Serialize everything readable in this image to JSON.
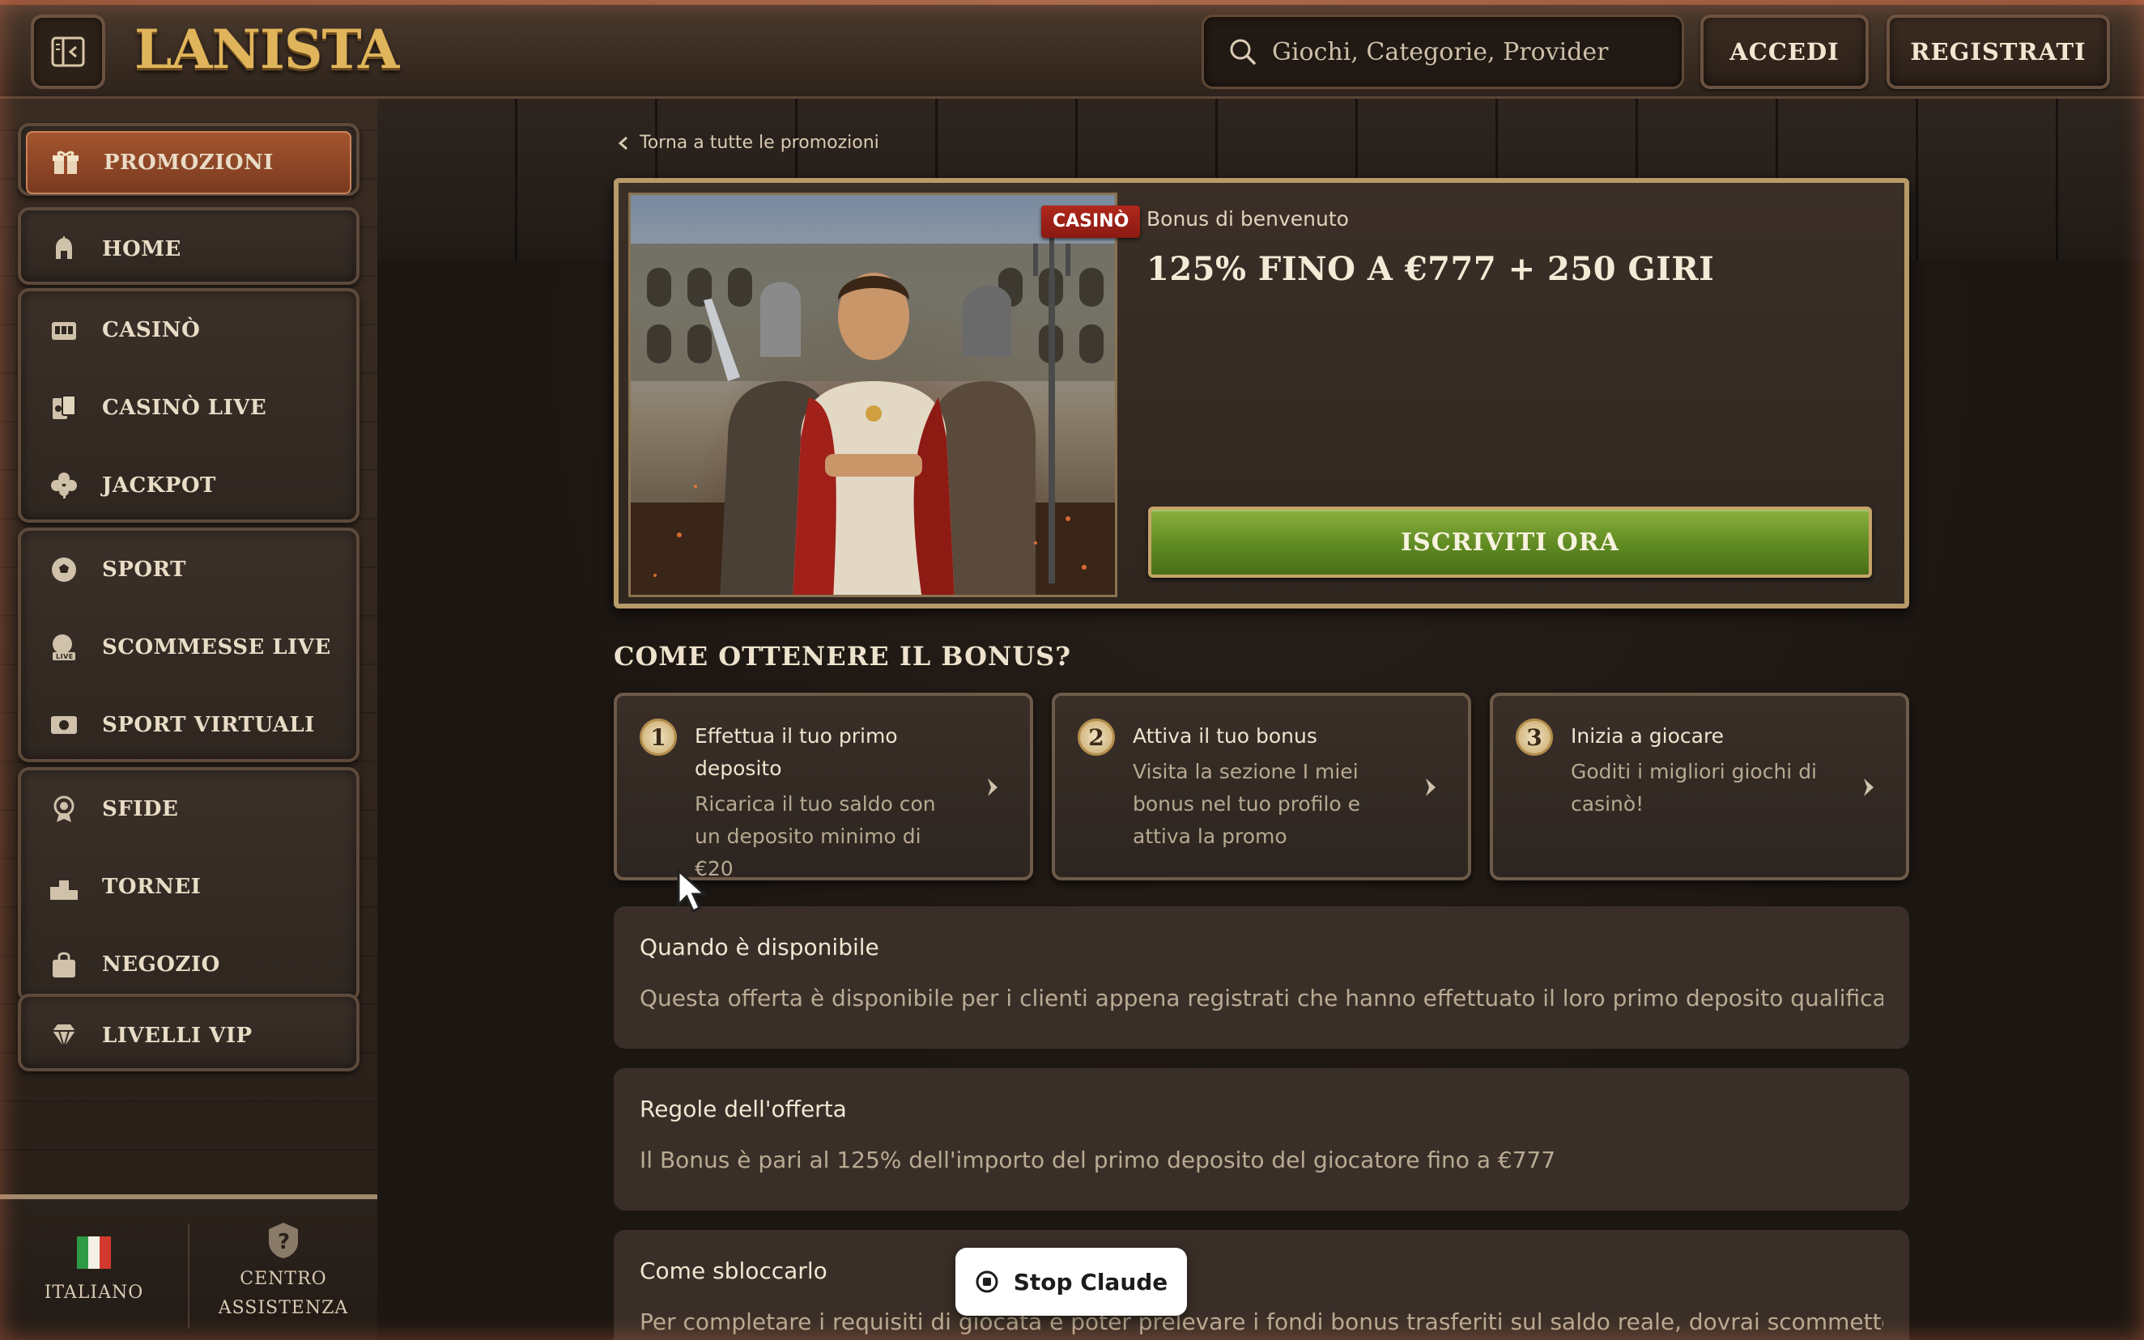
{
  "header": {
    "logo": "LANISTA",
    "search_placeholder": "Giochi, Categorie, Provider",
    "login_label": "ACCEDI",
    "register_label": "REGISTRATI"
  },
  "sidebar": {
    "promo_label": "PROMOZIONI",
    "home_label": "HOME",
    "casino_label": "CASINÒ",
    "casino_live_label": "CASINÒ LIVE",
    "jackpot_label": "JACKPOT",
    "sport_label": "SPORT",
    "live_bets_label": "SCOMMESSE LIVE",
    "virtual_sports_label": "SPORT VIRTUALI",
    "challenges_label": "SFIDE",
    "tournaments_label": "TORNEI",
    "shop_label": "NEGOZIO",
    "vip_label": "LIVELLI VIP",
    "language_label": "ITALIANO",
    "help_label_1": "CENTRO",
    "help_label_2": "ASSISTENZA"
  },
  "main": {
    "back_link": "Torna a tutte le promozioni",
    "promo": {
      "badge": "CASINÒ",
      "subtitle": "Bonus di benvenuto",
      "title": "125% FINO A €777 + 250 GIRI",
      "cta_label": "ISCRIVITI ORA"
    },
    "how_title": "COME OTTENERE IL BONUS?",
    "steps": [
      {
        "num": "1",
        "title": "Effettua il tuo primo deposito",
        "desc": "Ricarica il tuo saldo con un deposito minimo di €20"
      },
      {
        "num": "2",
        "title": "Attiva il tuo bonus",
        "desc": "Visita la sezione I miei bonus nel tuo profilo e attiva la promo"
      },
      {
        "num": "3",
        "title": "Inizia a giocare",
        "desc": "Goditi i migliori giochi di casinò!"
      }
    ],
    "panels": [
      {
        "title": "Quando è disponibile",
        "text": "Questa offerta è disponibile per i clienti appena registrati che hanno effettuato il loro primo deposito qualificante."
      },
      {
        "title": "Regole dell'offerta",
        "text": "Il Bonus è pari al 125% dell'importo del primo deposito del giocatore fino a €777"
      },
      {
        "title": "Come sbloccarlo",
        "text": "Per completare i requisiti di giocata e poter prelevare i fondi bonus trasferiti sul saldo reale, dovrai scommettere (bonus +"
      }
    ]
  },
  "overlay": {
    "stop_label": "Stop Claude"
  }
}
